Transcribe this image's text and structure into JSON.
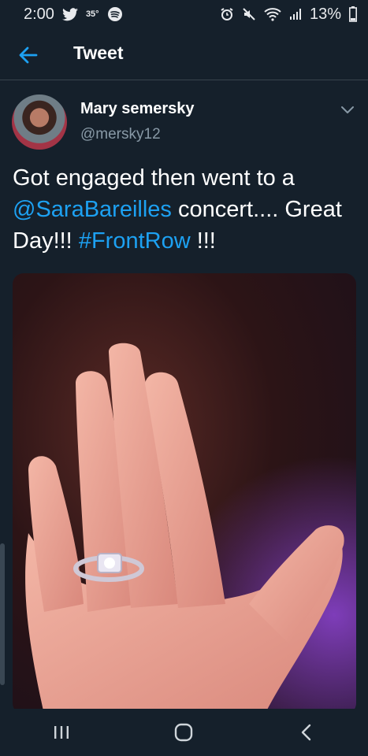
{
  "status_bar": {
    "time": "2:00",
    "temp": "35°",
    "battery": "13%"
  },
  "header": {
    "title": "Tweet"
  },
  "tweet": {
    "author_name": "Mary semersky",
    "author_handle": "@mersky12",
    "text_part1": "Got engaged then went to a ",
    "mention": "@SaraBareilles",
    "text_part2": " concert.... Great Day!!! ",
    "hashtag": "#FrontRow",
    "text_part3": " !!!"
  },
  "colors": {
    "background": "#15202b",
    "link": "#1da1f2",
    "secondary_text": "#8899a6",
    "divider": "#38444d"
  },
  "icons": {
    "back": "arrow-left",
    "more": "chevron-down",
    "nav_recents": "recents-bars",
    "nav_home": "home-rounded-square",
    "nav_back": "chevron-left"
  }
}
